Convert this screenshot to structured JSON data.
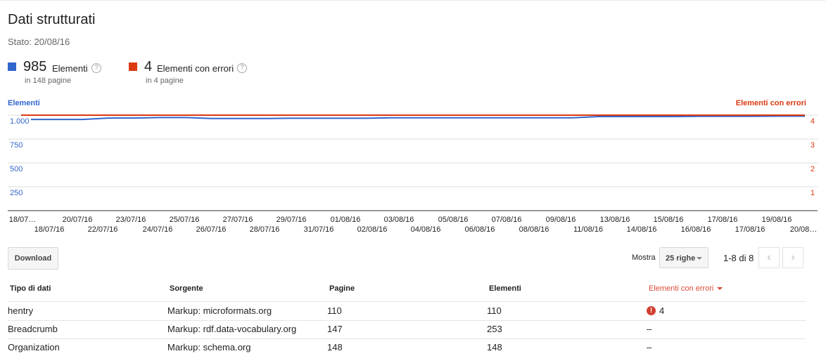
{
  "header": {
    "title": "Dati strutturati",
    "status": "Stato: 20/08/16"
  },
  "metrics": [
    {
      "value": "985",
      "label": "Elementi",
      "sub": "in 148 pagine",
      "color": "#3366cc"
    },
    {
      "value": "4",
      "label": "Elementi con errori",
      "sub": "in 4 pagine",
      "color": "#dc3912"
    }
  ],
  "help_glyph": "?",
  "chart_data": {
    "type": "line",
    "left_axis_label": "Elementi",
    "right_axis_label": "Elementi con errori",
    "left_ticks": [
      "250",
      "500",
      "750",
      "1.000"
    ],
    "right_ticks": [
      "1",
      "2",
      "3",
      "4"
    ],
    "ylim_left": [
      0,
      1000
    ],
    "ylim_right": [
      0,
      4
    ],
    "x_labels_top": [
      "18/07…",
      "20/07/16",
      "23/07/16",
      "25/07/16",
      "27/07/16",
      "29/07/16",
      "01/08/16",
      "03/08/16",
      "05/08/16",
      "07/08/16",
      "09/08/16",
      "13/08/16",
      "15/08/16",
      "17/08/16",
      "19/08/16"
    ],
    "x_labels_bottom": [
      "18/07/16",
      "22/07/16",
      "24/07/16",
      "26/07/16",
      "28/07/16",
      "31/07/16",
      "02/08/16",
      "04/08/16",
      "06/08/16",
      "08/08/16",
      "11/08/16",
      "14/08/16",
      "16/08/16",
      "17/08/16",
      "20/08…"
    ],
    "series": [
      {
        "name": "Elementi",
        "color": "#3366cc",
        "axis": "left",
        "values": [
          955,
          955,
          955,
          970,
          970,
          975,
          975,
          965,
          965,
          965,
          968,
          968,
          968,
          968,
          972,
          972,
          972,
          972,
          972,
          972,
          972,
          972,
          985,
          985,
          985,
          985,
          988,
          988,
          988,
          990,
          990
        ]
      },
      {
        "name": "Elementi con errori",
        "color": "#dc3912",
        "axis": "right",
        "values": [
          4,
          4,
          4,
          4,
          4,
          4,
          4,
          4,
          4,
          4,
          4,
          4,
          4,
          4,
          4,
          4,
          4,
          4,
          4,
          4,
          4,
          4,
          4,
          4,
          4,
          4,
          4,
          4,
          4,
          4,
          4
        ]
      }
    ]
  },
  "toolbar": {
    "download_label": "Download",
    "show_label": "Mostra",
    "rows_value": "25 righe",
    "page_info": "1-8 di 8",
    "prev_glyph": "‹",
    "next_glyph": "›"
  },
  "table": {
    "headers": [
      "Tipo di dati",
      "Sorgente",
      "Pagine",
      "Elementi",
      "Elementi con errori"
    ],
    "rows": [
      {
        "type": "hentry",
        "source": "Markup: microformats.org",
        "pages": "110",
        "items": "110",
        "errors": "4",
        "has_error": true
      },
      {
        "type": "Breadcrumb",
        "source": "Markup: rdf.data-vocabulary.org",
        "pages": "147",
        "items": "253",
        "errors": "–",
        "has_error": false
      },
      {
        "type": "Organization",
        "source": "Markup: schema.org",
        "pages": "148",
        "items": "148",
        "errors": "–",
        "has_error": false
      }
    ],
    "error_glyph": "!"
  }
}
